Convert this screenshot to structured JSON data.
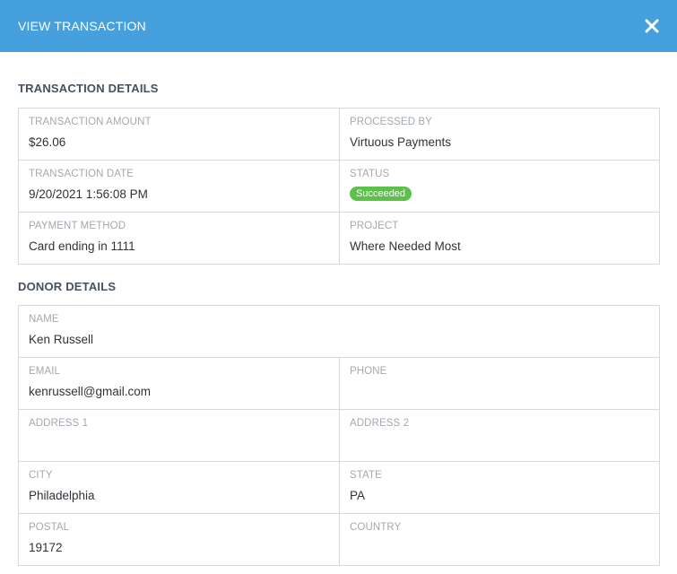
{
  "modal": {
    "title": "VIEW TRANSACTION",
    "close_icon": "close-icon"
  },
  "transaction": {
    "section_title": "TRANSACTION DETAILS",
    "amount_label": "TRANSACTION AMOUNT",
    "amount_value": "$26.06",
    "processed_by_label": "PROCESSED BY",
    "processed_by_value": "Virtuous Payments",
    "date_label": "TRANSACTION DATE",
    "date_value": "9/20/2021 1:56:08 PM",
    "status_label": "STATUS",
    "status_value": "Succeeded",
    "status_color": "#5cc04a",
    "payment_method_label": "PAYMENT METHOD",
    "payment_method_value": "Card ending in 1111",
    "project_label": "PROJECT",
    "project_value": "Where Needed Most"
  },
  "donor": {
    "section_title": "DONOR DETAILS",
    "name_label": "NAME",
    "name_value": "Ken Russell",
    "email_label": "EMAIL",
    "email_value": "kenrussell@gmail.com",
    "phone_label": "PHONE",
    "phone_value": "",
    "address1_label": "ADDRESS 1",
    "address1_value": "",
    "address2_label": "ADDRESS 2",
    "address2_value": "",
    "city_label": "CITY",
    "city_value": "Philadelphia",
    "state_label": "STATE",
    "state_value": "PA",
    "postal_label": "POSTAL",
    "postal_value": "19172",
    "country_label": "COUNTRY",
    "country_value": ""
  },
  "colors": {
    "header_bg": "#46a0dd",
    "border": "#d5d9dd"
  }
}
